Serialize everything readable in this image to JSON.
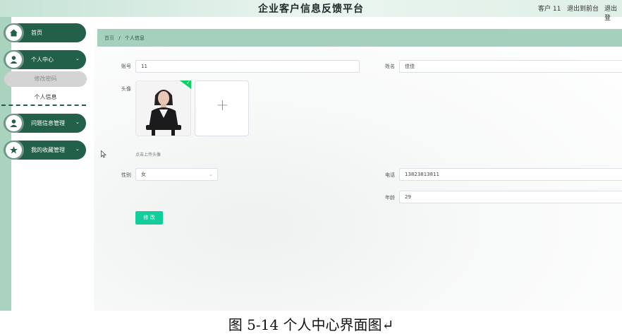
{
  "header": {
    "title": "企业客户信息反馈平台",
    "user": "客户 11",
    "links": [
      "退出到前台",
      "退出登"
    ]
  },
  "sidebar": {
    "items": [
      {
        "label": "首页",
        "icon": "home-icon"
      },
      {
        "label": "个人中心",
        "icon": "user-icon",
        "chevron": "⌄"
      },
      {
        "label": "问题信息管理",
        "icon": "user-icon",
        "chevron": "⌄"
      },
      {
        "label": "我的收藏管理",
        "icon": "star-icon",
        "chevron": "⌄"
      }
    ],
    "sub_items": [
      "修改密码",
      "个人信息"
    ]
  },
  "breadcrumb": {
    "home": "首页",
    "separator": "/",
    "current": "个人信息"
  },
  "form": {
    "account_label": "账号",
    "account_value": "11",
    "name_label": "姓名",
    "name_value": "佳佳",
    "avatar_label": "头像",
    "upload_hint": "点击上传头像",
    "upload_plus": "+",
    "gender_label": "性别",
    "gender_value": "女",
    "phone_label": "电话",
    "phone_value": "13823813811",
    "age_label": "年龄",
    "age_value": "29",
    "submit_label": "修 改"
  },
  "caption": "图 5-14 个人中心界面图↵",
  "colors": {
    "sidebar_pill": "#22604a",
    "breadcrumb_bar": "#a5d0bd",
    "accent": "#13ce9a"
  }
}
